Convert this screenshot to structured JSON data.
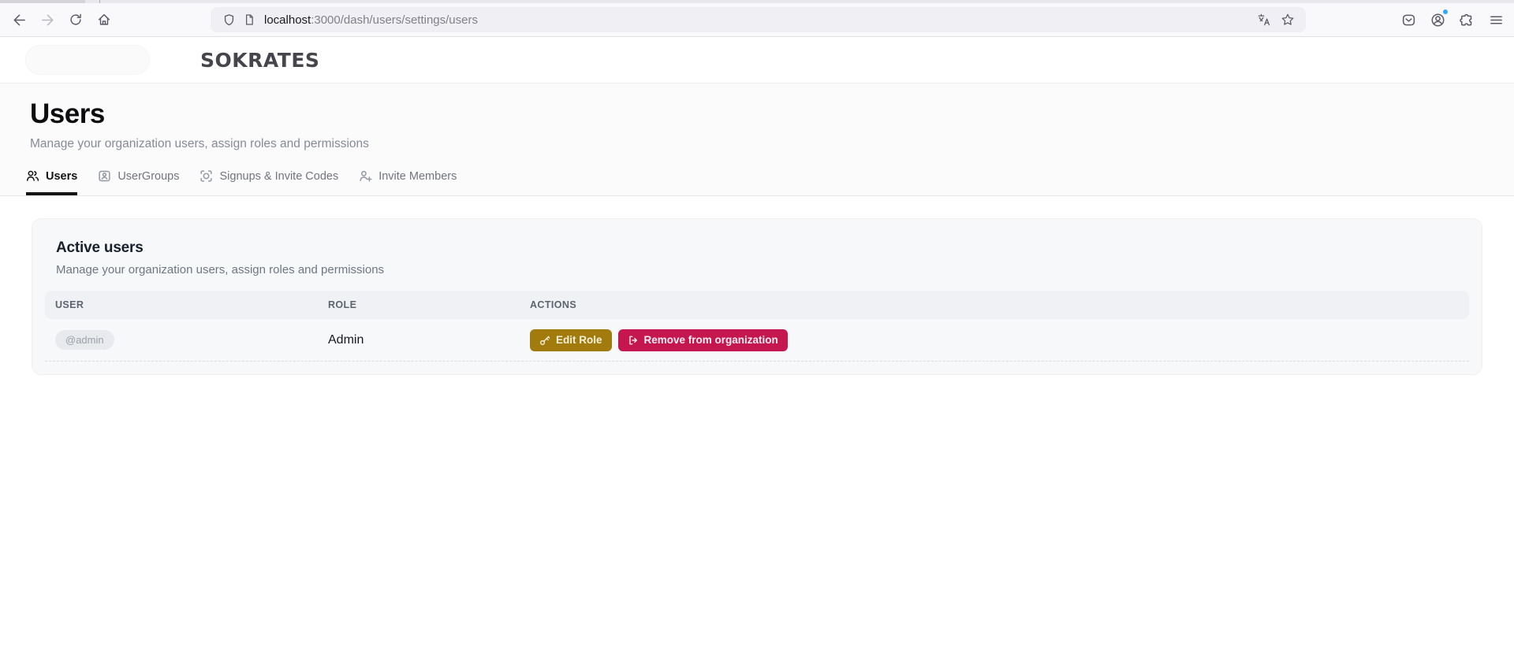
{
  "colors": {
    "edit-btn-bg": "#a17c0d",
    "edit-btn-fg": "#f8f0d9",
    "remove-btn-bg": "#c5174f",
    "remove-btn-fg": "#ffeef3",
    "notif-dot": "#30a8ff"
  },
  "browser": {
    "url": {
      "host": "localhost",
      "rest": ":3000/dash/users/settings/users"
    },
    "toolbar_icons": [
      "back-icon",
      "forward-icon",
      "reload-icon",
      "home-icon",
      "shield-icon",
      "page-icon",
      "translate-icon",
      "bookmark-star-icon",
      "pocket-icon",
      "account-icon",
      "extensions-icon",
      "menu-icon"
    ]
  },
  "header": {
    "logo": "SOKRATES"
  },
  "page": {
    "title": "Users",
    "subtitle": "Manage your organization users, assign roles and permissions"
  },
  "tabs": [
    {
      "label": "Users",
      "icon": "users-icon",
      "active": true
    },
    {
      "label": "UserGroups",
      "icon": "id-card-icon",
      "active": false
    },
    {
      "label": "Signups & Invite Codes",
      "icon": "scan-circle-icon",
      "active": false
    },
    {
      "label": "Invite Members",
      "icon": "person-plus-icon",
      "active": false
    }
  ],
  "card": {
    "title": "Active users",
    "subtitle": "Manage your organization users, assign roles and permissions",
    "columns": {
      "user": "USER",
      "role": "ROLE",
      "actions": "ACTIONS"
    },
    "row": {
      "user_badge": "@admin",
      "role": "Admin",
      "edit_label": "Edit Role",
      "remove_label": "Remove from organization"
    }
  }
}
